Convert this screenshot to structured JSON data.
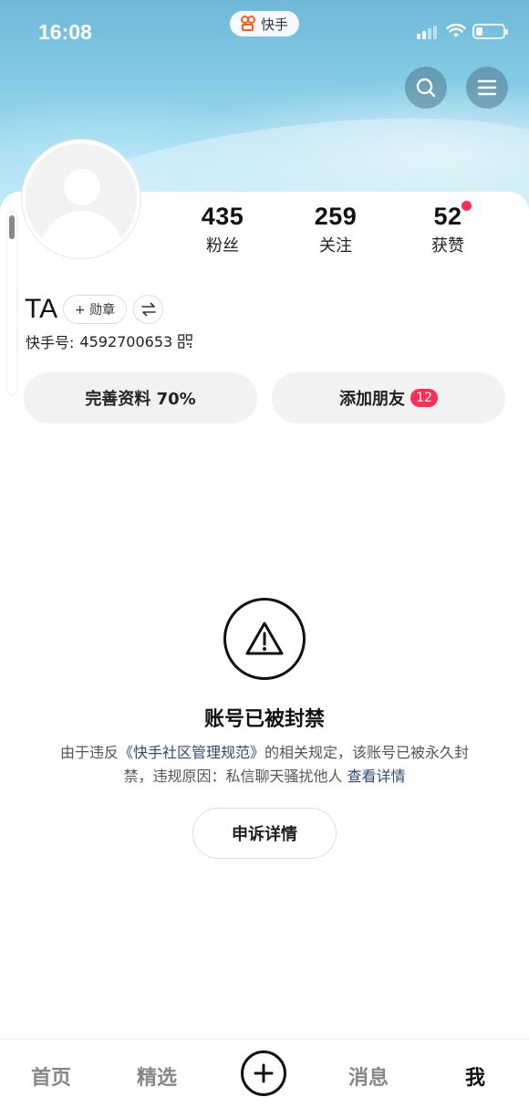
{
  "status_bar": {
    "time": "16:08",
    "app_name": "快手",
    "battery_level": 0.2
  },
  "header": {
    "search_icon": "search-icon",
    "menu_icon": "menu-icon"
  },
  "profile": {
    "username": "TA",
    "badge_label": "+ 勋章",
    "kuaishou_id_label": "快手号:",
    "kuaishou_id": "4592700653",
    "stats": {
      "fans": {
        "count": "435",
        "label": "粉丝"
      },
      "following": {
        "count": "259",
        "label": "关注"
      },
      "likes": {
        "count": "52",
        "label": "获赞"
      }
    }
  },
  "actions": {
    "complete_profile": "完善资料 70%",
    "add_friends": "添加朋友",
    "add_friends_count": "12"
  },
  "ban_notice": {
    "title": "账号已被封禁",
    "desc_prefix": "由于违反",
    "rules_link": "《快手社区管理规范》",
    "desc_middle": "的相关规定，该账号已被永久封禁，违规原因：私信聊天骚扰他人",
    "details_link": "查看详情",
    "appeal_button": "申诉详情"
  },
  "tabbar": {
    "home": "首页",
    "featured": "精选",
    "messages": "消息",
    "me": "我"
  },
  "colors": {
    "accent_red": "#ff2e55",
    "link_blue": "#2c4a78",
    "logo_orange": "#ff5a1f"
  }
}
